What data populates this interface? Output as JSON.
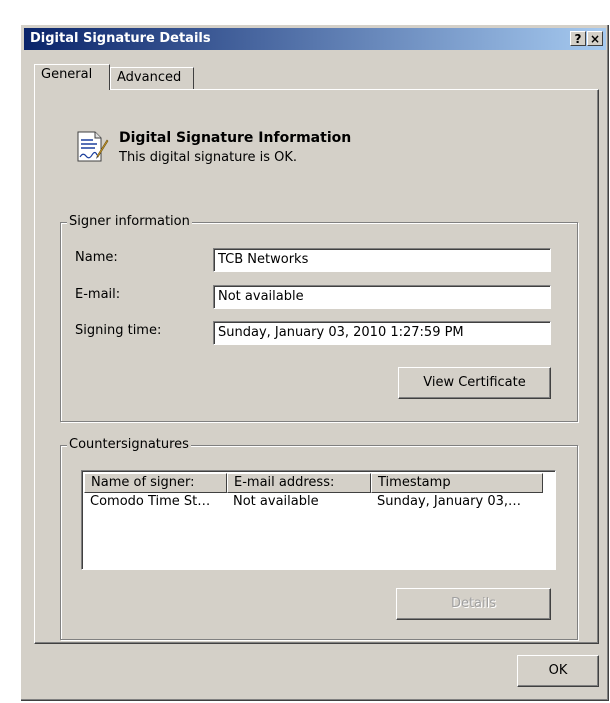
{
  "window": {
    "title": "Digital Signature Details",
    "help_glyph": "?",
    "close_glyph": "×"
  },
  "tabs": [
    {
      "label": "General",
      "selected": true
    },
    {
      "label": "Advanced",
      "selected": false
    }
  ],
  "header": {
    "icon": "document-signature-icon",
    "title": "Digital Signature Information",
    "status": "This digital signature is OK."
  },
  "signer": {
    "group_label": "Signer information",
    "name_label": "Name:",
    "name_value": "TCB Networks",
    "email_label": "E-mail:",
    "email_value": "Not available",
    "time_label": "Signing time:",
    "time_value": "Sunday, January 03, 2010 1:27:59 PM",
    "view_cert_label": "View Certificate"
  },
  "counter": {
    "group_label": "Countersignatures",
    "columns": [
      "Name of signer:",
      "E-mail address:",
      "Timestamp"
    ],
    "rows": [
      [
        "Comodo Time St…",
        "Not available",
        "Sunday, January 03,…"
      ]
    ],
    "details_label": "Details"
  },
  "footer": {
    "ok_label": "OK"
  },
  "colors": {
    "face": "#d4d0c8",
    "title_start": "#0a246a",
    "title_end": "#a6caf0"
  }
}
